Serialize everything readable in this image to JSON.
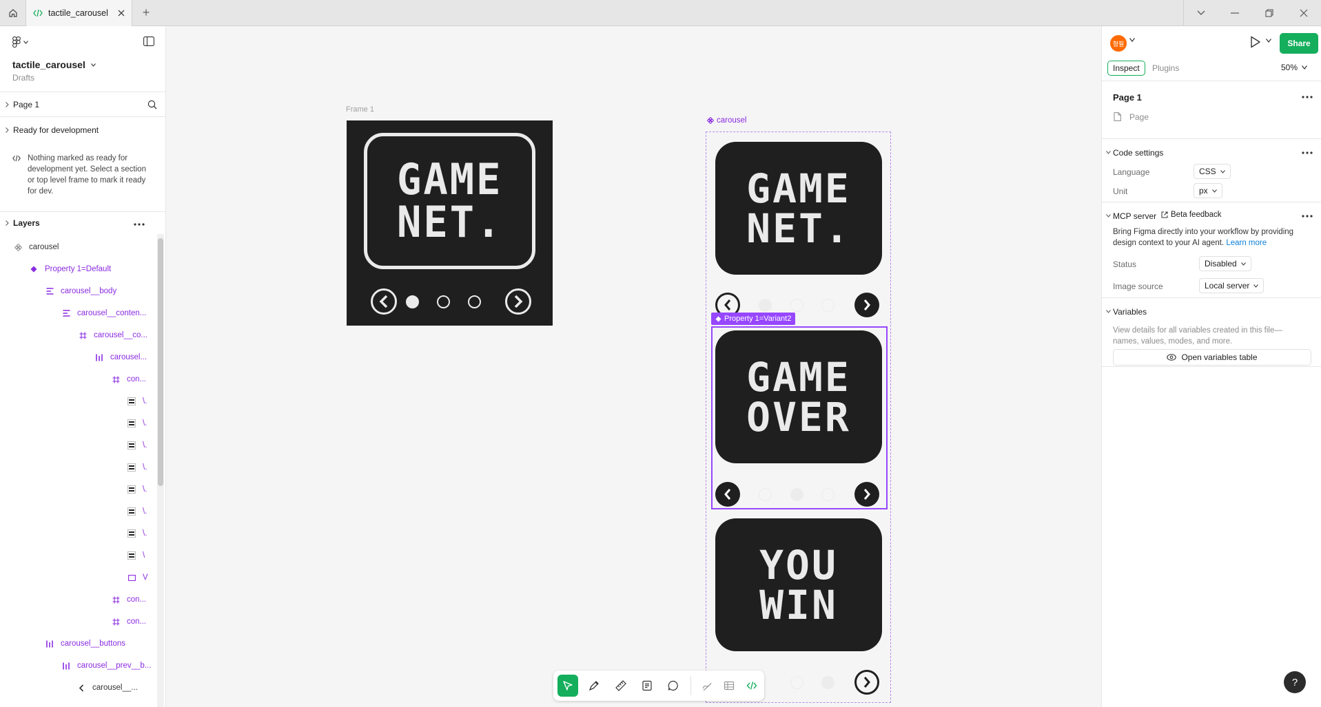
{
  "titlebar": {
    "tab_title": "tactile_carousel",
    "add_tab": "+"
  },
  "file": {
    "name": "tactile_carousel",
    "location": "Drafts"
  },
  "pages": {
    "current": "Page 1"
  },
  "ready_for_dev": {
    "title": "Ready for development",
    "message": "Nothing marked as ready for development yet. Select a section or top level frame to mark it ready for dev."
  },
  "layers": {
    "title": "Layers",
    "items": [
      {
        "label": "carousel",
        "icon": "component-set-icon"
      },
      {
        "label": "Property 1=Default",
        "icon": "component-icon"
      },
      {
        "label": "carousel__body",
        "icon": "vertical-autolayout-icon"
      },
      {
        "label": "carousel__conten...",
        "icon": "vertical-autolayout-icon"
      },
      {
        "label": "carousel__co...",
        "icon": "frame-icon"
      },
      {
        "label": "carousel...",
        "icon": "horizontal-autolayout-icon"
      },
      {
        "label": "con...",
        "icon": "frame-icon"
      },
      {
        "label": "\\.",
        "icon": "vector-icon"
      },
      {
        "label": "\\.",
        "icon": "vector-icon"
      },
      {
        "label": "\\.",
        "icon": "vector-icon"
      },
      {
        "label": "\\.",
        "icon": "vector-icon"
      },
      {
        "label": "\\.",
        "icon": "vector-icon"
      },
      {
        "label": "\\.",
        "icon": "vector-icon"
      },
      {
        "label": "\\.",
        "icon": "vector-icon"
      },
      {
        "label": "\\",
        "icon": "vector-icon"
      },
      {
        "label": "V",
        "icon": "rectangle-icon"
      },
      {
        "label": "con...",
        "icon": "frame-icon"
      },
      {
        "label": "con...",
        "icon": "frame-icon"
      },
      {
        "label": "carousel__buttons",
        "icon": "horizontal-autolayout-icon"
      },
      {
        "label": "carousel__prev__b...",
        "icon": "horizontal-autolayout-icon"
      },
      {
        "label": "carousel__...",
        "icon": "chevron-left-icon"
      }
    ]
  },
  "canvas": {
    "frame1_label": "Frame 1",
    "carousel_label": "carousel",
    "variant_tag": "Property 1=Variant2",
    "screens": [
      {
        "line1": "GAME",
        "line2": "NET."
      },
      {
        "line1": "GAME",
        "line2": "NET."
      },
      {
        "line1": "GAME",
        "line2": "OVER"
      },
      {
        "line1": "YOU",
        "line2": "WIN"
      }
    ]
  },
  "toolbar": {
    "tools": [
      "move-tool",
      "pen-tool",
      "measure-tool",
      "annotate-tool",
      "comment-tool",
      "draw-tool",
      "table-tool",
      "dev-mode-toggle"
    ]
  },
  "right_panel": {
    "avatar_initials": "형필",
    "share_label": "Share",
    "tabs": {
      "inspect": "Inspect",
      "plugins": "Plugins"
    },
    "zoom": "50%",
    "page": {
      "title": "Page 1",
      "type_label": "Page"
    },
    "code_settings": {
      "title": "Code settings",
      "language_label": "Language",
      "language_value": "CSS",
      "unit_label": "Unit",
      "unit_value": "px"
    },
    "mcp": {
      "title": "MCP server",
      "beta_label": "Beta feedback",
      "description": "Bring Figma directly into your workflow by providing design context to your AI agent.",
      "learn_more": "Learn more",
      "status_label": "Status",
      "status_value": "Disabled",
      "image_source_label": "Image source",
      "image_source_value": "Local server"
    },
    "variables": {
      "title": "Variables",
      "description": "View details for all variables created in this file—names, values, modes, and more.",
      "button": "Open variables table"
    }
  },
  "help_label": "?",
  "colors": {
    "accent_green": "#14ae5c",
    "selection_purple": "#9747ff",
    "component_purple": "#8a2be2",
    "screen_dark": "#1f1f1f"
  }
}
